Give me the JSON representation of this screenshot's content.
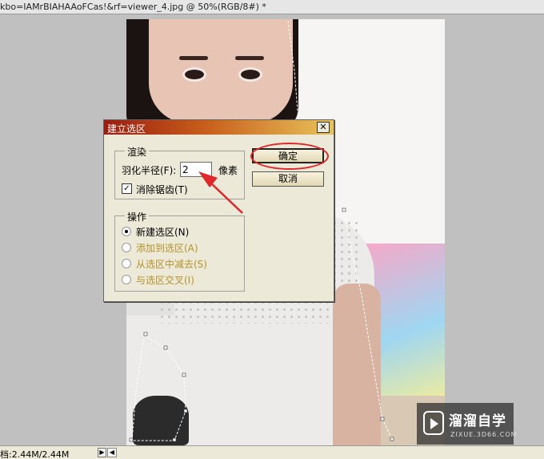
{
  "window": {
    "title": "kbo=IAMrBIAHAAoFCas!&rf=viewer_4.jpg @ 50%(RGB/8#) *"
  },
  "dialog": {
    "title": "建立选区",
    "close_glyph": "✕",
    "render_group": {
      "label": "渲染",
      "feather_label": "羽化半径(F):",
      "feather_value": "2",
      "feather_unit": "像素",
      "antialias_checked": true,
      "antialias_label": "消除锯齿(T)"
    },
    "operation_group": {
      "label": "操作",
      "options": [
        {
          "label": "新建选区(N)",
          "selected": true,
          "enabled": true
        },
        {
          "label": "添加到选区(A)",
          "selected": false,
          "enabled": false
        },
        {
          "label": "从选区中减去(S)",
          "selected": false,
          "enabled": false
        },
        {
          "label": "与选区交叉(I)",
          "selected": false,
          "enabled": false
        }
      ]
    },
    "buttons": {
      "ok": "确定",
      "cancel": "取消"
    }
  },
  "annotation": {
    "color": "#e0272c"
  },
  "watermark": {
    "title": "溜溜自学",
    "subtitle": "ZIXUE.3D66.COM"
  },
  "statusbar": {
    "doc_size": "档:2.44M/2.44M",
    "arrow_glyph": "▶",
    "scroll_glyph": "◀"
  }
}
